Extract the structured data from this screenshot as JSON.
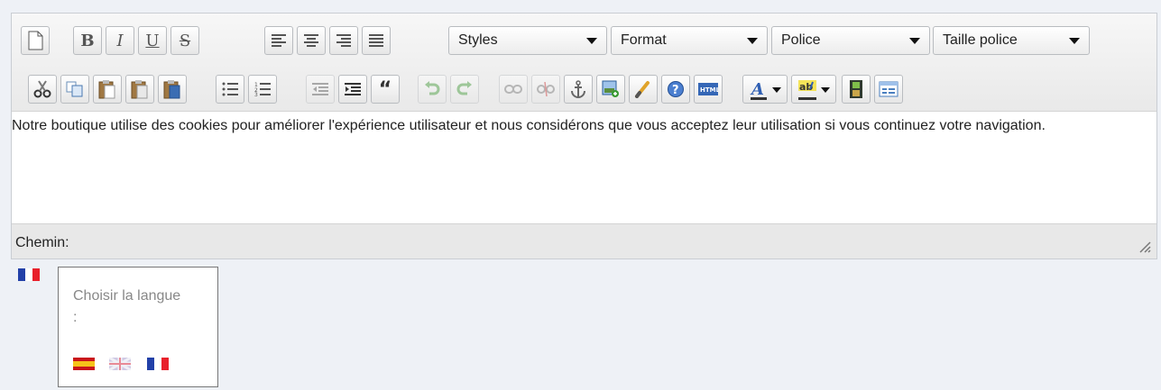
{
  "toolbar": {
    "row1_buttons": [
      {
        "name": "new-document-button",
        "icon": "new-document-icon"
      },
      {
        "name": "bold-button",
        "glyph": "B"
      },
      {
        "name": "italic-button",
        "glyph": "I"
      },
      {
        "name": "underline-button",
        "glyph": "U"
      },
      {
        "name": "strikethrough-button",
        "glyph": "S"
      },
      {
        "name": "align-left-button",
        "icon": "align-left-icon"
      },
      {
        "name": "align-center-button",
        "icon": "align-center-icon"
      },
      {
        "name": "align-right-button",
        "icon": "align-right-icon"
      },
      {
        "name": "align-justify-button",
        "icon": "align-justify-icon"
      }
    ],
    "dropdowns": {
      "styles": "Styles",
      "format": "Format",
      "font": "Police",
      "font_size": "Taille police"
    }
  },
  "content": {
    "text": "Notre boutique utilise des cookies pour améliorer l'expérience utilisateur et nous considérons que vous acceptez leur utilisation si vous continuez votre navigation."
  },
  "statusbar": {
    "path_label": "Chemin:"
  },
  "language": {
    "current_flag": "fr-flag-icon",
    "box_title": "Choisir la langue :",
    "options": [
      "es-flag-icon",
      "gb-flag-icon",
      "fr-flag-icon"
    ]
  },
  "colors": {
    "accent_blue": "#3f7fcf",
    "icon_green": "#4a9a3c",
    "disabled_green": "#8fcf8a"
  }
}
